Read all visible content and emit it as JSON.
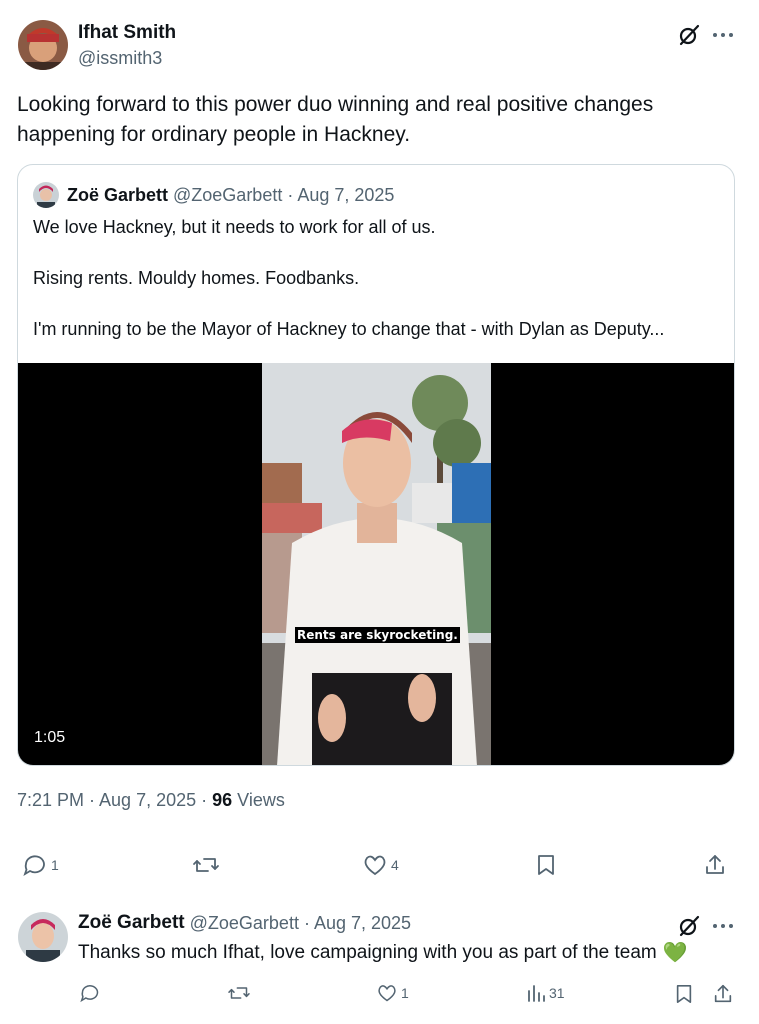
{
  "tweet": {
    "author_name": "Ifhat Smith",
    "author_handle": "@issmith3",
    "text": "Looking forward to this power duo winning and real positive changes happening for ordinary people in Hackney.",
    "timestamp": "7:21 PM · Aug 7, 2025 · ",
    "views_count": "96",
    "views_label": " Views",
    "replies": "1",
    "retweets": "",
    "likes": "4"
  },
  "quote": {
    "author_name": "Zoë Garbett",
    "author_meta": "@ZoeGarbett · Aug 7, 2025",
    "line1": "We love Hackney, but it needs to work for all of us.",
    "line2": "Rising rents. Mouldy homes. Foodbanks.",
    "line3": "I'm running to be the Mayor of Hackney to change that - with Dylan as Deputy...",
    "video_caption": "Rents are skyrocketing.",
    "video_duration": "1:05"
  },
  "reply": {
    "author_name": "Zoë Garbett",
    "author_meta": "@ZoeGarbett · Aug 7, 2025",
    "text": "Thanks so much Ifhat, love campaigning with you as part of the team",
    "emoji": "💚",
    "replies": "",
    "likes": "1",
    "views": "31"
  },
  "icons": {
    "grok": "grok-icon",
    "more": "more-icon",
    "reply": "reply-icon",
    "retweet": "retweet-icon",
    "like": "like-icon",
    "bookmark": "bookmark-icon",
    "share": "share-icon",
    "views": "views-icon"
  },
  "colors": {
    "text": "#0f1419",
    "muted": "#536471",
    "border": "#cfd9de",
    "heart_emoji": "#5fb85a"
  }
}
